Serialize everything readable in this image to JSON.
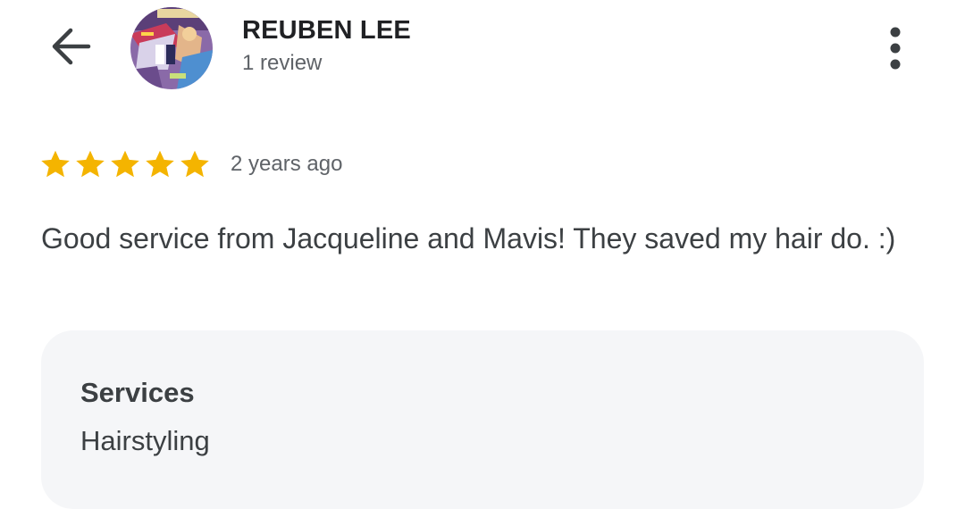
{
  "header": {
    "reviewer_name": "REUBEN LEE",
    "review_count": "1 review",
    "back_icon": "arrow-back-icon",
    "more_icon": "more-vertical-icon"
  },
  "review": {
    "rating": 5,
    "rating_max": 5,
    "time_ago": "2 years ago",
    "text": "Good service from Jacqueline and Mavis! They saved my hair do. :)"
  },
  "services": {
    "heading": "Services",
    "value": "Hairstyling"
  },
  "colors": {
    "star": "#f4b400",
    "card_background": "#f5f6f8",
    "secondary_text": "#5f6368"
  }
}
